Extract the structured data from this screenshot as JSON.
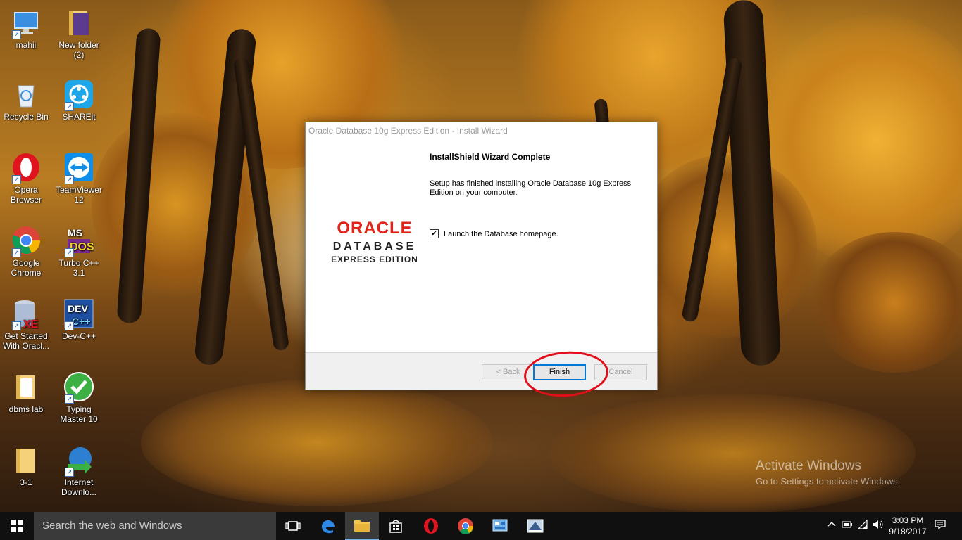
{
  "desktop": {
    "icons": [
      {
        "id": "mahii",
        "label": "mahii"
      },
      {
        "id": "new-folder",
        "label": "New folder\n(2)"
      },
      {
        "id": "recycle-bin",
        "label": "Recycle Bin"
      },
      {
        "id": "shareit",
        "label": "SHAREit"
      },
      {
        "id": "opera",
        "label": "Opera\nBrowser"
      },
      {
        "id": "teamviewer",
        "label": "TeamViewer\n12"
      },
      {
        "id": "chrome",
        "label": "Google\nChrome"
      },
      {
        "id": "turbo",
        "label": "Turbo C++\n3.1"
      },
      {
        "id": "getstarted",
        "label": "Get Started\nWith Oracl..."
      },
      {
        "id": "devcpp",
        "label": "Dev-C++"
      },
      {
        "id": "dbms",
        "label": "dbms lab"
      },
      {
        "id": "typing",
        "label": "Typing\nMaster 10"
      },
      {
        "id": "folder31",
        "label": "3-1"
      },
      {
        "id": "idm",
        "label": "Internet\nDownlo..."
      }
    ]
  },
  "dialog": {
    "title": "Oracle Database 10g Express Edition - Install Wizard",
    "logo_word": "ORACLE",
    "logo_line2": "DATABASE",
    "logo_line3": "EXPRESS EDITION",
    "heading": "InstallShield Wizard Complete",
    "message": "Setup has finished installing Oracle Database 10g Express Edition on your computer.",
    "checkbox_label": "Launch the Database homepage.",
    "checkbox_checked": true,
    "back_label": "< Back",
    "finish_label": "Finish",
    "cancel_label": "Cancel"
  },
  "watermark": {
    "line1": "Activate Windows",
    "line2": "Go to Settings to activate Windows."
  },
  "taskbar": {
    "search_placeholder": "Search the web and Windows",
    "time": "3:03 PM",
    "date": "9/18/2017",
    "accent": "#0078d7"
  }
}
